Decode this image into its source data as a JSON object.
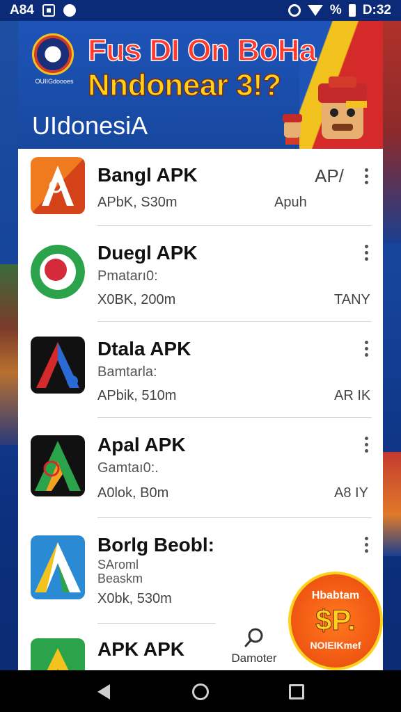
{
  "status_bar": {
    "left_text": "A84",
    "time": "D:32",
    "icons": [
      "gallery-icon",
      "record-icon",
      "alarm-icon",
      "wifi-icon",
      "signal-icon",
      "battery-icon"
    ],
    "percent_glyph": "%"
  },
  "banner": {
    "title_line1": "Fus DI On BoHa",
    "title_line2": "Nndonear 3!?",
    "subtitle": "UIdonesiA",
    "logo_caption": "OUIIGdoooes",
    "colors": {
      "blue": "#1e54b8",
      "red": "#ff3a2f",
      "yellow": "#ffd21e"
    }
  },
  "apps": [
    {
      "name": "Bangl APK",
      "sub": "",
      "meta": "APbK, S30m",
      "tag": "AP/",
      "tag2": "Apuh",
      "icon": "apk-orange-icon"
    },
    {
      "name": "Duegl APK",
      "sub": "Pmatarı0:",
      "meta": "X0BK, 200m",
      "tag": "TANY",
      "icon": "apk-green-circle-icon"
    },
    {
      "name": "Dtala APK",
      "sub": "Bamtarla:",
      "meta": "APbik, 510m",
      "tag": "AR IK",
      "icon": "apk-black-a-icon"
    },
    {
      "name": "Apal APK",
      "sub": "Gamtaı0:.",
      "meta": "A0lok, B0m",
      "tag": "A8 IY",
      "icon": "apk-black-green-a-icon"
    },
    {
      "name": "Borlg Beobl:",
      "sub": "SAroml",
      "sub2": "Beaskm",
      "meta": "X0bk, 530m",
      "tag": "",
      "icon": "apk-blue-a-icon"
    },
    {
      "name": "APK APK",
      "sub": "",
      "meta": "",
      "tag": "",
      "icon": "apk-green-a-icon"
    }
  ],
  "detector": {
    "label": "Damoter",
    "icon": "search-icon"
  },
  "promo": {
    "top": "Hbabtam",
    "mid": "$P.",
    "bottom": "NOIEIKmef"
  },
  "nav": {
    "back": "back-icon",
    "home": "home-icon",
    "recents": "recents-icon"
  }
}
